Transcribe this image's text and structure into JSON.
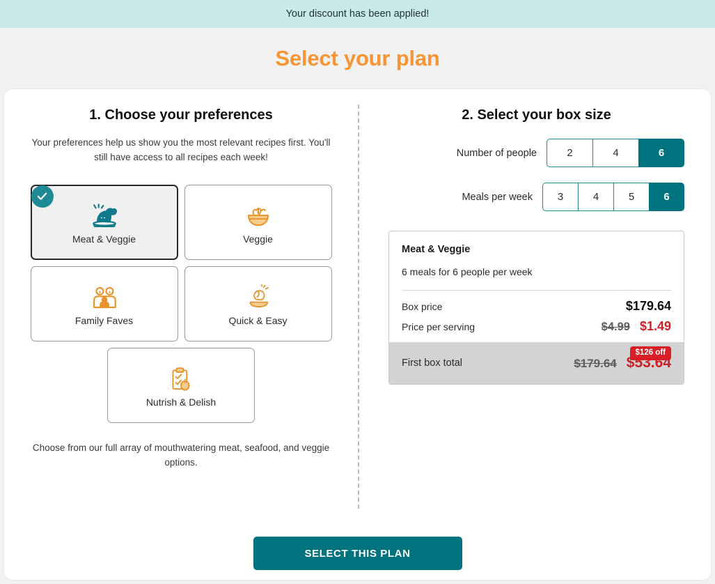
{
  "banner": {
    "message": "Your discount has been applied!",
    "background_color": "#c7e9e8"
  },
  "page_title": "Select your plan",
  "title_color": "#f79433",
  "steps": {
    "preferences": {
      "heading": "1. Choose your preferences",
      "description": "Your preferences help us show you the most relevant recipes first. You'll still have access to all recipes each week!",
      "footnote": "Choose from our full array of mouthwatering meat, seafood, and veggie options.",
      "options": [
        {
          "label": "Meat & Veggie",
          "icon": "roast-turkey-icon",
          "selected": true,
          "icon_color": "#12798a"
        },
        {
          "label": "Veggie",
          "icon": "salad-bowl-icon",
          "selected": false,
          "icon_color": "#e8922a"
        },
        {
          "label": "Family Faves",
          "icon": "family-group-icon",
          "selected": false,
          "icon_color": "#e8922a"
        },
        {
          "label": "Quick & Easy",
          "icon": "hand-plate-icon",
          "selected": false,
          "icon_color": "#e8922a"
        },
        {
          "label": "Nutrish & Delish",
          "icon": "clipboard-apple-icon",
          "selected": false,
          "icon_color": "#e8922a"
        }
      ]
    },
    "box_size": {
      "heading": "2. Select your box size",
      "people": {
        "label": "Number of people",
        "options": [
          "2",
          "4",
          "6"
        ],
        "selected": "6"
      },
      "meals": {
        "label": "Meals per week",
        "options": [
          "3",
          "4",
          "5",
          "6"
        ],
        "selected": "6"
      }
    }
  },
  "summary": {
    "plan_name": "Meat & Veggie",
    "plan_detail": "6 meals for 6 people per week",
    "rows": [
      {
        "label": "Box price",
        "original": "",
        "price": "$179.64"
      },
      {
        "label": "Price per serving",
        "original": "$4.99",
        "price": "$1.49"
      }
    ],
    "total": {
      "label": "First box total",
      "original": "$179.64",
      "price": "$53.64",
      "badge": "$126 off",
      "badge_color": "#d81f26"
    }
  },
  "cta": {
    "label": "SELECT THIS PLAN",
    "color": "#00737f"
  }
}
